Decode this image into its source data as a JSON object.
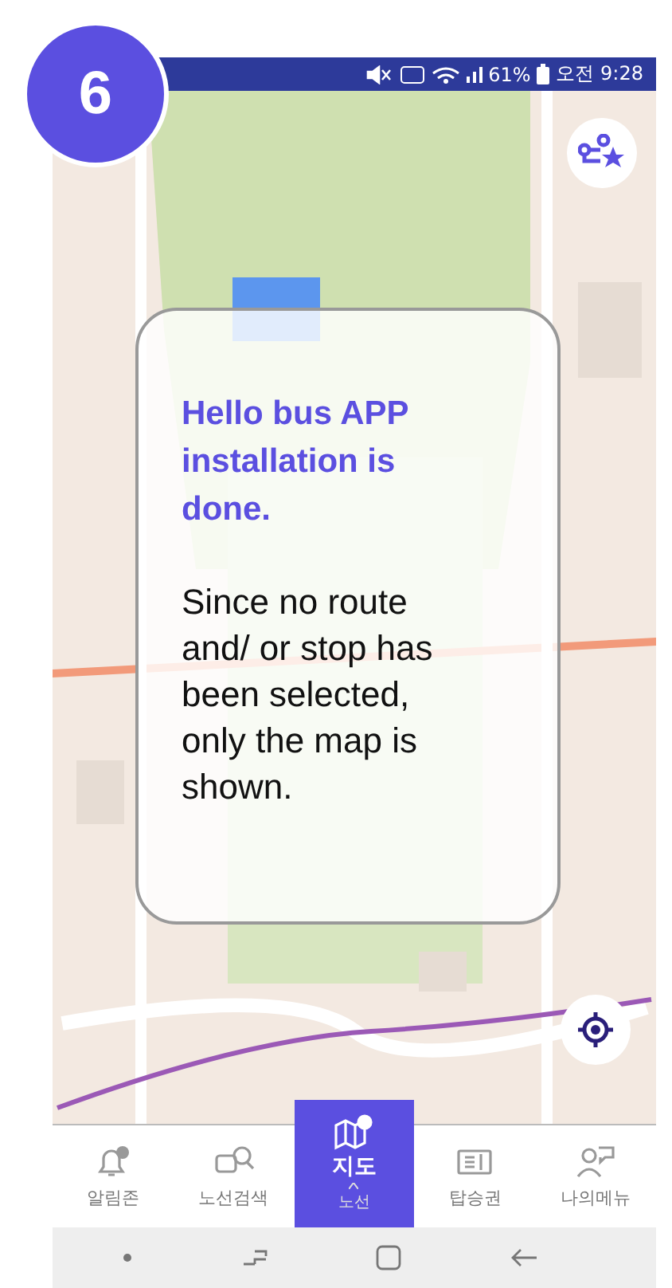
{
  "step_badge": "6",
  "status_bar": {
    "battery": "61%",
    "time": "오전 9:28"
  },
  "message": {
    "title": "Hello bus APP installation is done.",
    "body": "Since no route and/ or stop has been selected, only the map is shown."
  },
  "nav_tabs": [
    {
      "label": "알림존",
      "selected": false
    },
    {
      "label": "노선검색",
      "selected": false
    },
    {
      "label": "지도",
      "sub_label": "노선",
      "selected": true
    },
    {
      "label": "탑승권",
      "selected": false
    },
    {
      "label": "나의메뉴",
      "selected": false
    }
  ]
}
